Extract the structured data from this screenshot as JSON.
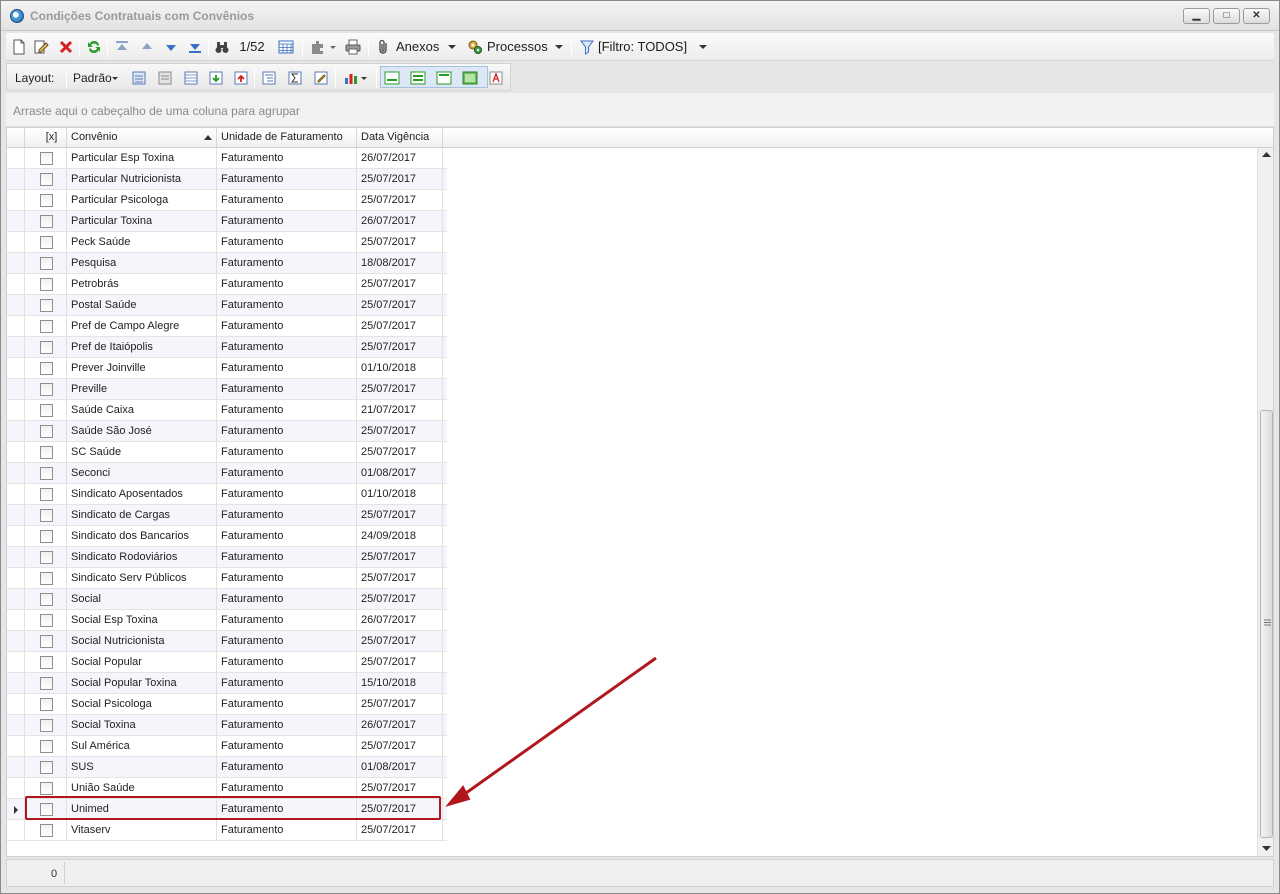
{
  "window": {
    "title": "Condições Contratuais com Convênios",
    "controls": {
      "minimize": "▁",
      "maximize": "□",
      "close": "✕"
    }
  },
  "toolbar": {
    "record_position": "1/52",
    "anexos_label": "Anexos",
    "processos_label": "Processos",
    "filter_label": "[Filtro: TODOS]"
  },
  "layout_bar": {
    "layout_label": "Layout:",
    "preset_label": "Padrão"
  },
  "group_panel": {
    "hint": "Arraste aqui o cabeçalho de uma coluna para agrupar"
  },
  "grid": {
    "columns": [
      "[x]",
      "Convênio",
      "Unidade de Faturamento",
      "Data Vigência"
    ],
    "sorted_column": "Convênio",
    "rows": [
      {
        "convenio": "Particular Esp Toxina",
        "unidade": "Faturamento",
        "data": "26/07/2017"
      },
      {
        "convenio": "Particular Nutricionista",
        "unidade": "Faturamento",
        "data": "25/07/2017"
      },
      {
        "convenio": "Particular Psicologa",
        "unidade": "Faturamento",
        "data": "25/07/2017"
      },
      {
        "convenio": "Particular Toxina",
        "unidade": "Faturamento",
        "data": "26/07/2017"
      },
      {
        "convenio": "Peck Saúde",
        "unidade": "Faturamento",
        "data": "25/07/2017"
      },
      {
        "convenio": "Pesquisa",
        "unidade": "Faturamento",
        "data": "18/08/2017"
      },
      {
        "convenio": "Petrobrás",
        "unidade": "Faturamento",
        "data": "25/07/2017"
      },
      {
        "convenio": "Postal Saúde",
        "unidade": "Faturamento",
        "data": "25/07/2017"
      },
      {
        "convenio": "Pref de Campo Alegre",
        "unidade": "Faturamento",
        "data": "25/07/2017"
      },
      {
        "convenio": "Pref de Itaiópolis",
        "unidade": "Faturamento",
        "data": "25/07/2017"
      },
      {
        "convenio": "Prever Joinville",
        "unidade": "Faturamento",
        "data": "01/10/2018"
      },
      {
        "convenio": "Preville",
        "unidade": "Faturamento",
        "data": "25/07/2017"
      },
      {
        "convenio": "Saúde Caixa",
        "unidade": "Faturamento",
        "data": "21/07/2017"
      },
      {
        "convenio": "Saúde São José",
        "unidade": "Faturamento",
        "data": "25/07/2017"
      },
      {
        "convenio": "SC Saúde",
        "unidade": "Faturamento",
        "data": "25/07/2017"
      },
      {
        "convenio": "Seconci",
        "unidade": "Faturamento",
        "data": "01/08/2017"
      },
      {
        "convenio": "Sindicato Aposentados",
        "unidade": "Faturamento",
        "data": "01/10/2018"
      },
      {
        "convenio": "Sindicato de Cargas",
        "unidade": "Faturamento",
        "data": "25/07/2017"
      },
      {
        "convenio": "Sindicato dos Bancarios",
        "unidade": "Faturamento",
        "data": "24/09/2018"
      },
      {
        "convenio": "Sindicato Rodoviários",
        "unidade": "Faturamento",
        "data": "25/07/2017"
      },
      {
        "convenio": "Sindicato Serv Públicos",
        "unidade": "Faturamento",
        "data": "25/07/2017"
      },
      {
        "convenio": "Social",
        "unidade": "Faturamento",
        "data": "25/07/2017"
      },
      {
        "convenio": "Social Esp Toxina",
        "unidade": "Faturamento",
        "data": "26/07/2017"
      },
      {
        "convenio": "Social Nutricionista",
        "unidade": "Faturamento",
        "data": "25/07/2017"
      },
      {
        "convenio": "Social Popular",
        "unidade": "Faturamento",
        "data": "25/07/2017"
      },
      {
        "convenio": "Social Popular Toxina",
        "unidade": "Faturamento",
        "data": "15/10/2018"
      },
      {
        "convenio": "Social Psicologa",
        "unidade": "Faturamento",
        "data": "25/07/2017"
      },
      {
        "convenio": "Social Toxina",
        "unidade": "Faturamento",
        "data": "26/07/2017"
      },
      {
        "convenio": "Sul América",
        "unidade": "Faturamento",
        "data": "25/07/2017"
      },
      {
        "convenio": "SUS",
        "unidade": "Faturamento",
        "data": "01/08/2017"
      },
      {
        "convenio": "União Saúde",
        "unidade": "Faturamento",
        "data": "25/07/2017"
      },
      {
        "convenio": "Unimed",
        "unidade": "Faturamento",
        "data": "25/07/2017",
        "current": true
      },
      {
        "convenio": "Vitaserv",
        "unidade": "Faturamento",
        "data": "25/07/2017"
      }
    ]
  },
  "footer": {
    "selected_count": "0"
  },
  "colors": {
    "annotation": "#b0161b",
    "alt_row": "#f5f5fc",
    "accent": "#1c5f9e"
  }
}
